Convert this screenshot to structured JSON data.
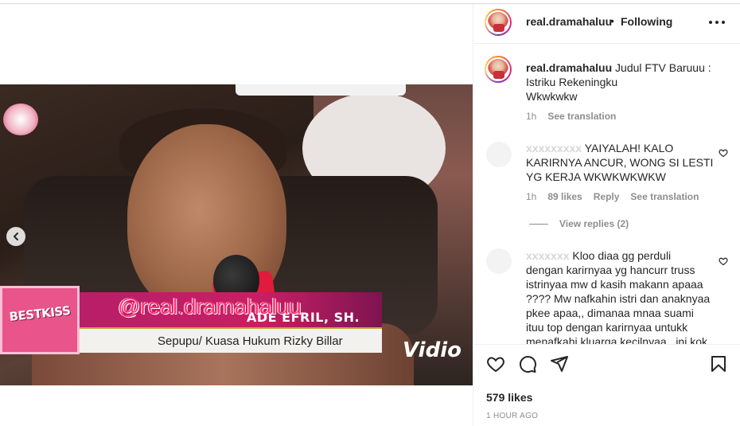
{
  "post": {
    "username": "real.dramahaluu",
    "separator": "•",
    "follow_status": "Following",
    "likes": "579 likes",
    "time_ago": "1 HOUR AGO"
  },
  "video": {
    "watermark": "@real.dramahaluu",
    "lower_third_logo": "BESTKISS",
    "person_name": "ADE EFRIL, SH.",
    "person_title": "Sepupu/ Kuasa Hukum Rizky Billar",
    "network_logo": "Vidio"
  },
  "caption": {
    "username": "real.dramahaluu",
    "text_line1": "Judul FTV Baruuu :",
    "text_line2": "Istriku Rekeningku",
    "text_line3": "Wkwkwkw",
    "time": "1h",
    "translate": "See translation"
  },
  "comments": [
    {
      "username_visible": "",
      "line1": "YAIYALAH! KALO",
      "line2": "KARIRNYA ANCUR, WONG SI LESTI",
      "line3": "YG KERJA WKWKWKWKW",
      "time": "1h",
      "likes": "89 likes",
      "reply": "Reply",
      "translate": "See translation",
      "view_replies": "View replies (2)"
    },
    {
      "line1": "Kloo diaa gg perduli",
      "line2": "dengan karirnyaa yg hancurr truss",
      "line3": "istrinyaa mw d kasih makann apaaa",
      "line4": "???? Mw nafkahin istri dan anaknyaa",
      "line5": "pkee apaa,, dimanaa mnaa suami",
      "line6": "ituu top dengan karirnyaa untukk",
      "line7": "menafkahi kluarga kecilnyaa.. ini kok"
    }
  ],
  "icons": {
    "more": "more-horizontal-icon",
    "prev": "chevron-left-icon",
    "like": "heart-icon",
    "comment": "comment-icon",
    "share": "share-icon",
    "save": "bookmark-icon"
  }
}
